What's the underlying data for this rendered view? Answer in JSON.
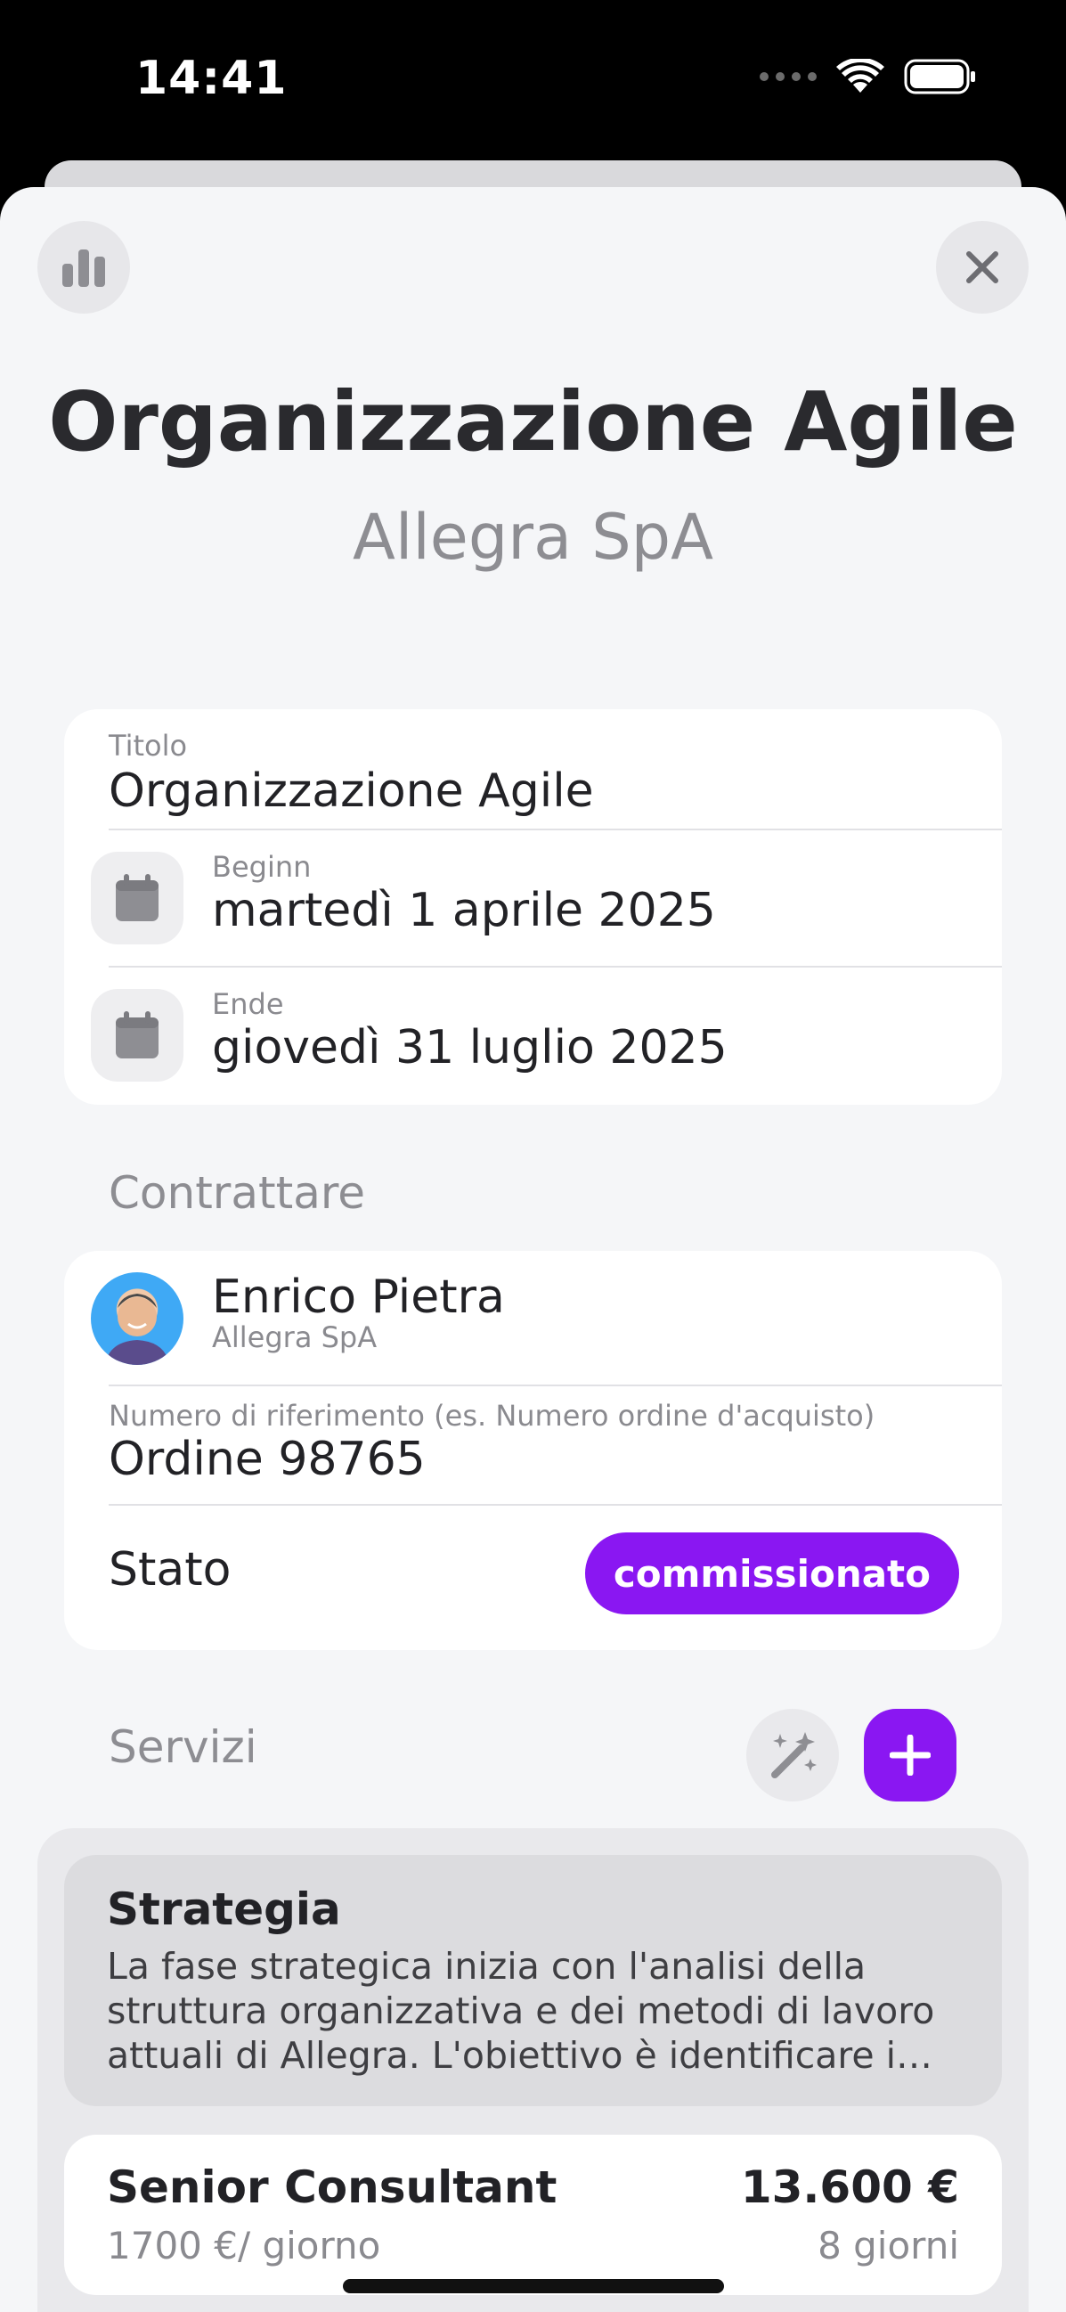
{
  "status_bar": {
    "time": "14:41"
  },
  "header": {
    "title": "Organizzazione Agile",
    "subtitle": "Allegra SpA"
  },
  "project": {
    "title_label": "Titolo",
    "title_value": "Organizzazione Agile",
    "start_label": "Beginn",
    "start_value": "martedì 1 aprile 2025",
    "end_label": "Ende",
    "end_value": "giovedì 31 luglio 2025"
  },
  "contractor": {
    "section_label": "Contrattare",
    "name": "Enrico Pietra",
    "company": "Allegra SpA",
    "reference_label": "Numero di riferimento (es. Numero ordine d'acquisto)",
    "reference_value": "Ordine 98765",
    "status_label": "Stato",
    "status_value": "commissionato"
  },
  "services": {
    "section_label": "Servizi",
    "phase": {
      "title": "Strategia",
      "description": "La fase strategica inizia con l'analisi della struttura organizzativa e dei metodi di lavoro attuali di Allegra. L'obiettivo è identificare i…"
    },
    "items": [
      {
        "role": "Senior Consultant",
        "rate": "1700 €/ giorno",
        "total": "13.600 €",
        "days": "8 giorni"
      }
    ]
  },
  "colors": {
    "accent": "#8a17f2",
    "background": "#f5f6f8",
    "card": "#ffffff"
  }
}
